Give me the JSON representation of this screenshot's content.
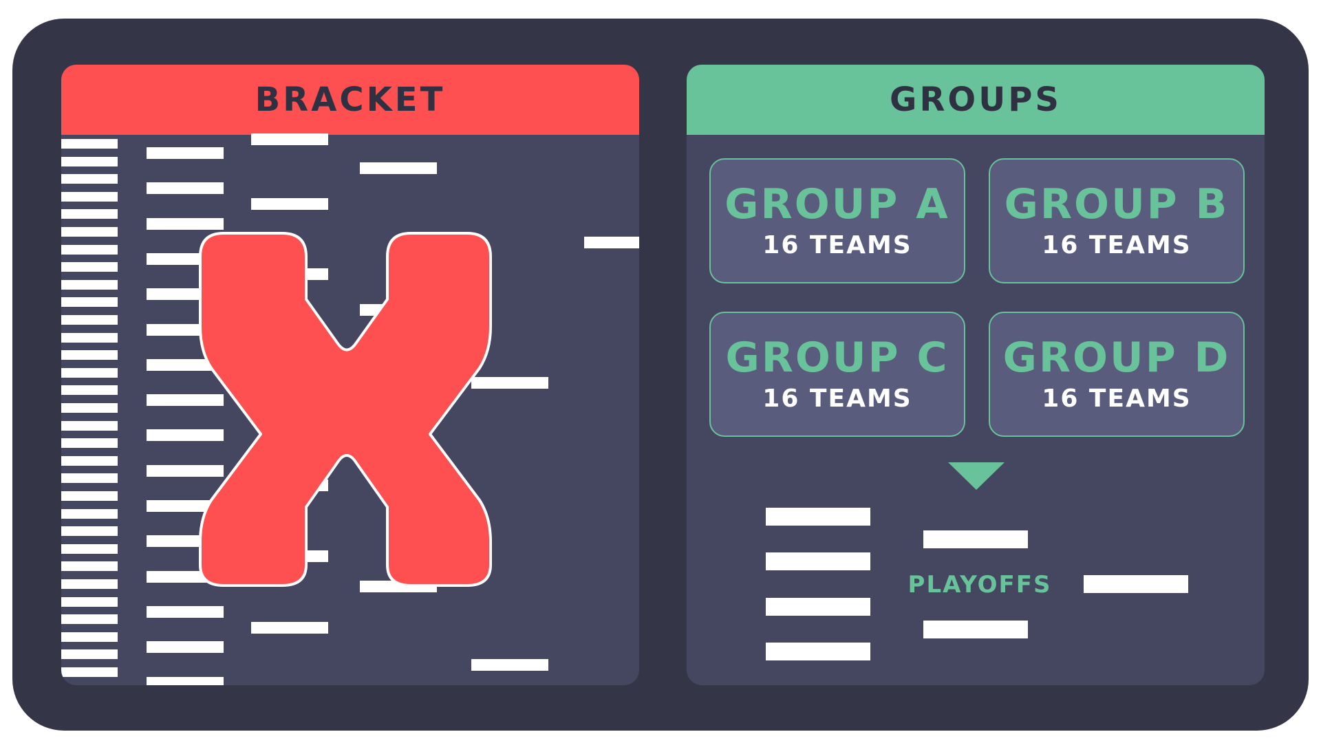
{
  "bracket": {
    "title": "BRACKET"
  },
  "groups": {
    "title": "GROUPS",
    "cards": [
      {
        "name": "GROUP A",
        "teams": "16 TEAMS"
      },
      {
        "name": "GROUP B",
        "teams": "16 TEAMS"
      },
      {
        "name": "GROUP C",
        "teams": "16 TEAMS"
      },
      {
        "name": "GROUP D",
        "teams": "16 TEAMS"
      }
    ]
  },
  "playoffs": {
    "label": "PLAYOFFS"
  },
  "colors": {
    "frame": "#343547",
    "panel": "#454760",
    "bracket_accent": "#fe5050",
    "groups_accent": "#68c39b",
    "card": "#595c7d"
  },
  "icons": {
    "cross": "x-cross-icon",
    "arrow": "triangle-down-icon"
  }
}
